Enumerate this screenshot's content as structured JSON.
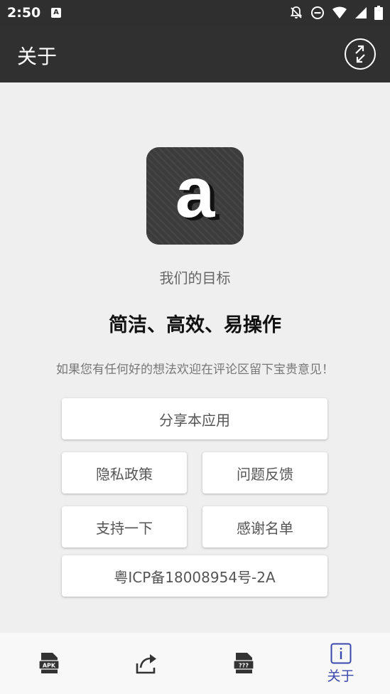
{
  "status_bar": {
    "time": "2:50",
    "app_icon_letter": "A",
    "icons": [
      "notifications-off-icon",
      "do-not-disturb-icon",
      "wifi-icon",
      "signal-icon",
      "battery-icon"
    ]
  },
  "app_bar": {
    "title": "关于",
    "action_icon": "switch-arrows-icon"
  },
  "about": {
    "logo_letter": "a",
    "goal_label": "我们的目标",
    "slogan": "简洁、高效、易操作",
    "invite_text": "如果您有任何好的想法欢迎在评论区留下宝贵意见！"
  },
  "buttons": {
    "share_app": "分享本应用",
    "privacy_policy": "隐私政策",
    "feedback": "问题反馈",
    "support": "支持一下",
    "thanks_list": "感谢名单",
    "icp": "粤ICP备18008954号-2A"
  },
  "bottom_nav": {
    "items": [
      {
        "icon": "apk-file-icon",
        "icon_text": "APK",
        "label": ""
      },
      {
        "icon": "share-icon",
        "label": ""
      },
      {
        "icon": "unknown-file-icon",
        "icon_text": "???",
        "label": ""
      },
      {
        "icon": "info-icon",
        "label": "关于",
        "active": true
      }
    ],
    "active_color": "#3949ab"
  },
  "colors": {
    "app_bar": "#303030",
    "background": "#efefef",
    "accent": "#3949ab"
  }
}
